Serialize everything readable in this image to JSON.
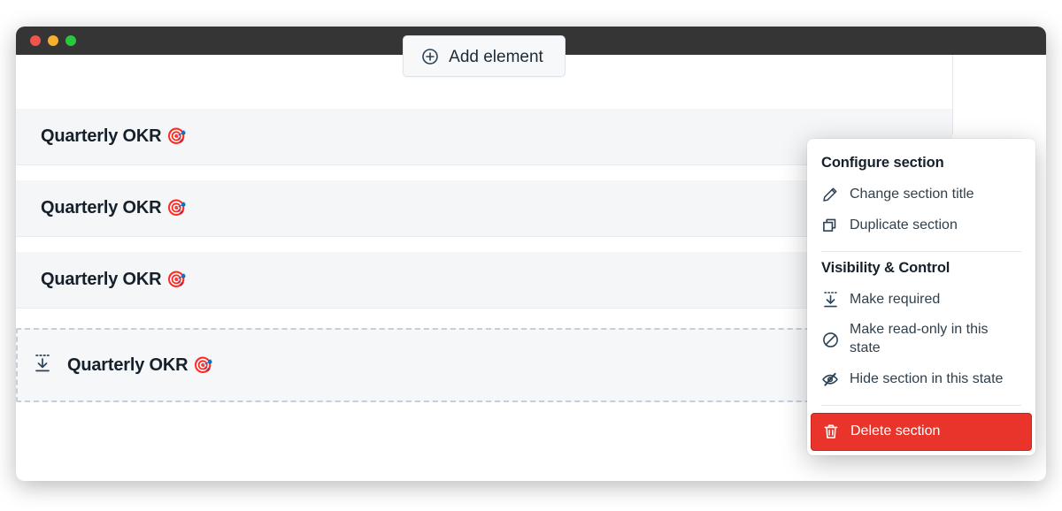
{
  "window": {
    "traffic_lights": [
      "close",
      "minimize",
      "maximize"
    ],
    "colors": {
      "titlebar": "#353535",
      "close": "#f0544b",
      "minimize": "#f5b02e",
      "maximize": "#28c93f",
      "danger": "#e8342a",
      "icon": "#2b4257",
      "section_band": "#f5f6f8",
      "selection_border": "#c3cfdb"
    }
  },
  "toolbar": {
    "add_element_label": "Add element",
    "add_element_icon": "plus-circle-icon"
  },
  "sections": [
    {
      "title": "Quarterly OKR",
      "emoji": "🎯",
      "selected": false,
      "required": false
    },
    {
      "title": "Quarterly OKR",
      "emoji": "🎯",
      "selected": false,
      "required": false
    },
    {
      "title": "Quarterly OKR",
      "emoji": "🎯",
      "selected": false,
      "required": false
    },
    {
      "title": "Quarterly OKR",
      "emoji": "🎯",
      "selected": true,
      "required": true
    }
  ],
  "row_controls": {
    "reorder_icon": "chevron-up-down-icon",
    "more_icon": "more-horizontal-icon"
  },
  "context_menu": {
    "groups": [
      {
        "title": "Configure section",
        "items": [
          {
            "label": "Change section title",
            "icon": "pencil-icon"
          },
          {
            "label": "Duplicate section",
            "icon": "duplicate-icon"
          }
        ]
      },
      {
        "title": "Visibility & Control",
        "items": [
          {
            "label": "Make required",
            "icon": "make-required-icon"
          },
          {
            "label": "Make read-only in this state",
            "icon": "circle-slash-icon"
          },
          {
            "label": "Hide section in this state",
            "icon": "eye-slash-icon"
          }
        ]
      }
    ],
    "danger_item": {
      "label": "Delete section",
      "icon": "trash-icon"
    }
  }
}
